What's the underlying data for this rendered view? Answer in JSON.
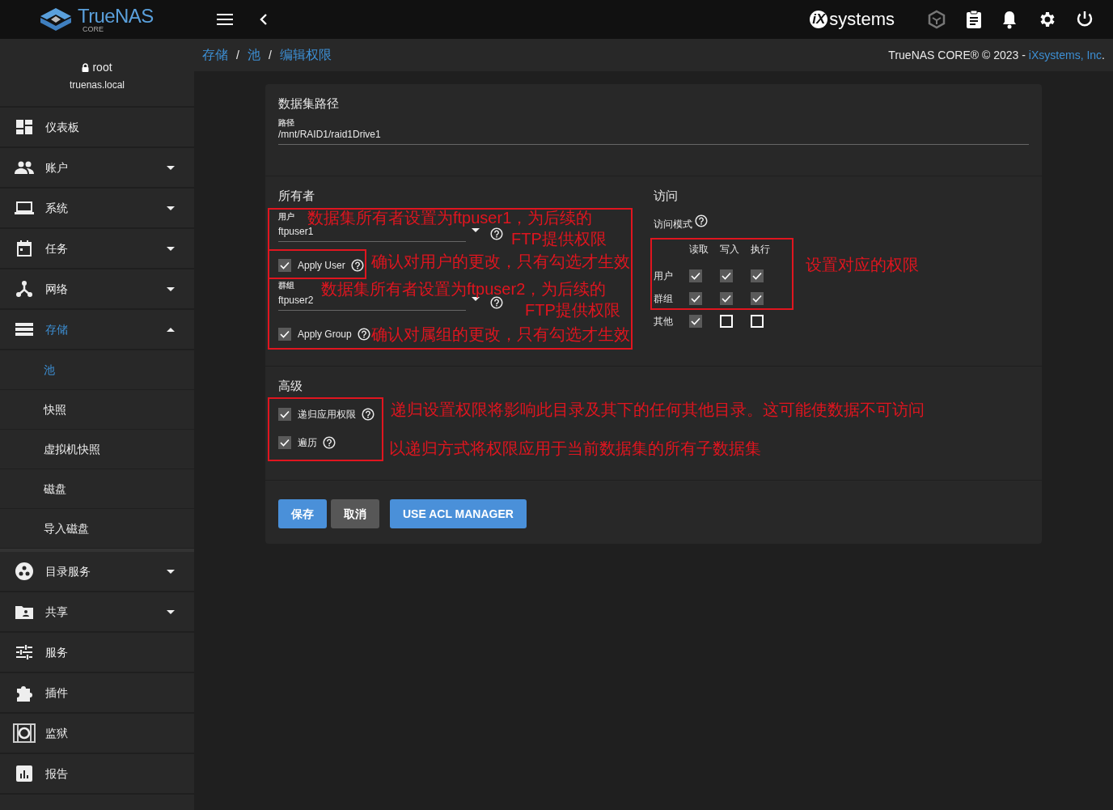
{
  "topbar": {
    "logo_text": "TrueNAS",
    "logo_subtext": "CORE",
    "vendor_badge": "iX",
    "vendor_text": "systems"
  },
  "user": {
    "name": "root",
    "host": "truenas.local"
  },
  "sidebar": {
    "items": [
      {
        "label": "仪表板",
        "kind": "link",
        "selected": false
      },
      {
        "label": "账户",
        "kind": "menu",
        "expanded": false,
        "selected": false
      },
      {
        "label": "系统",
        "kind": "menu",
        "expanded": false,
        "selected": false
      },
      {
        "label": "任务",
        "kind": "menu",
        "expanded": false,
        "selected": false
      },
      {
        "label": "网络",
        "kind": "menu",
        "expanded": false,
        "selected": false
      },
      {
        "label": "存储",
        "kind": "menu",
        "expanded": true,
        "selected": true,
        "children": [
          {
            "label": "池",
            "selected": true
          },
          {
            "label": "快照",
            "selected": false
          },
          {
            "label": "虚拟机快照",
            "selected": false
          },
          {
            "label": "磁盘",
            "selected": false
          },
          {
            "label": "导入磁盘",
            "selected": false
          }
        ]
      },
      {
        "label": "目录服务",
        "kind": "menu",
        "expanded": false,
        "selected": false
      },
      {
        "label": "共享",
        "kind": "menu",
        "expanded": false,
        "selected": false
      },
      {
        "label": "服务",
        "kind": "link",
        "selected": false
      },
      {
        "label": "插件",
        "kind": "link",
        "selected": false
      },
      {
        "label": "监狱",
        "kind": "link",
        "selected": false
      },
      {
        "label": "报告",
        "kind": "link",
        "selected": false
      }
    ]
  },
  "breadcrumb": [
    {
      "label": "存储",
      "separator": "/"
    },
    {
      "label": "池",
      "separator": "/"
    },
    {
      "label": "编辑权限"
    }
  ],
  "copyright": {
    "text": "TrueNAS CORE® © 2023 -",
    "link": "iXsystems, Inc",
    "end": "."
  },
  "dataset": {
    "title": "数据集路径",
    "path_label": "路径",
    "path": "/mnt/RAID1/raid1Drive1"
  },
  "owner": {
    "title": "所有者",
    "user": {
      "label": "用户",
      "value": "ftpuser1"
    },
    "apply_user": {
      "label": "Apply User",
      "checked": true
    },
    "group": {
      "label": "群组",
      "value": "ftpuser2"
    },
    "apply_group": {
      "label": "Apply Group",
      "checked": true
    }
  },
  "access": {
    "title": "访问",
    "mode_label": "访问模式",
    "columns": [
      "读取",
      "写入",
      "执行"
    ],
    "rows": [
      {
        "label": "用户",
        "cells": [
          {
            "checked": true
          },
          {
            "checked": true
          },
          {
            "checked": true
          }
        ]
      },
      {
        "label": "群组",
        "cells": [
          {
            "checked": true
          },
          {
            "checked": true
          },
          {
            "checked": true
          }
        ]
      },
      {
        "label": "其他",
        "cells": [
          {
            "checked": true
          },
          {
            "checked": false
          },
          {
            "checked": false
          }
        ]
      }
    ]
  },
  "advanced": {
    "title": "高级",
    "options": [
      {
        "label": "递归应用权限",
        "checked": true
      },
      {
        "label": "遍历",
        "checked": true
      }
    ]
  },
  "buttons": [
    {
      "label": "保存",
      "kind": "primary"
    },
    {
      "label": "取消",
      "kind": "secondary"
    },
    {
      "label": "USE ACL MANAGER",
      "kind": "primary"
    }
  ],
  "annotations": [
    {
      "kind": "box"
    },
    {
      "kind": "box"
    },
    {
      "kind": "note",
      "lines": [
        "数据集所有者设置为ftpuser1，为后续的",
        "FTP提供权限"
      ]
    },
    {
      "kind": "note",
      "lines": [
        "确认对用户的更改，只有勾选才生效"
      ]
    },
    {
      "kind": "note",
      "lines": [
        "数据集所有者设置为ftpuser2，为后续的",
        "FTP提供权限"
      ]
    },
    {
      "kind": "note",
      "lines": [
        "确认对属组的更改，只有勾选才生效"
      ]
    },
    {
      "kind": "box"
    },
    {
      "kind": "note",
      "lines": [
        "设置对应的权限"
      ]
    },
    {
      "kind": "box"
    },
    {
      "kind": "note",
      "lines": [
        "递归设置权限将影响此目录及其下的任何其他目录。这可能使数据不可访问"
      ]
    },
    {
      "kind": "note",
      "lines": [
        "以递归方式将权限应用于当前数据集的所有子数据集"
      ]
    }
  ]
}
